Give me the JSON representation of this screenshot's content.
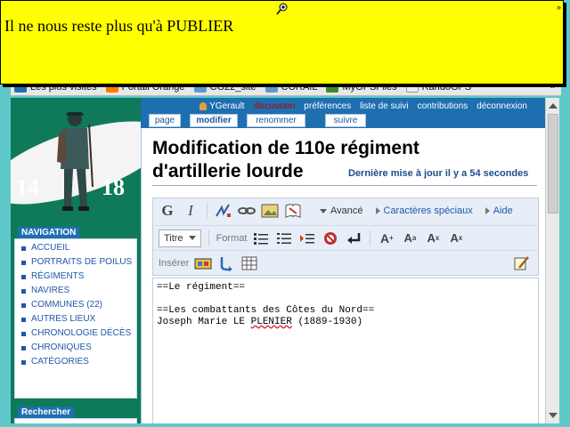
{
  "note": {
    "text": "Il ne nous reste plus qu'à PUBLIER"
  },
  "bookmarks": [
    {
      "label": "Les plus visités",
      "icon": "bookmark-star-icon",
      "color": "#1e6fb0"
    },
    {
      "label": "Portail Orange",
      "icon": "orange-logo-icon",
      "color": "#ff7900"
    },
    {
      "label": "CG22_site",
      "icon": "site-icon",
      "color": "#5a9ad0"
    },
    {
      "label": "CORAIL",
      "icon": "site-icon",
      "color": "#5a9ad0"
    },
    {
      "label": "MyGPSFiles",
      "icon": "gps-icon",
      "color": "#3a8a2a"
    },
    {
      "label": "RandoGPS",
      "icon": "page-icon",
      "color": "#eeeeee"
    }
  ],
  "logo": {
    "left_number": "14",
    "right_number": "18"
  },
  "sidebar": {
    "navigation_heading": "NAVIGATION",
    "nav_items": [
      "ACCUEIL",
      "PORTRAITS DE POILUS",
      "RÉGIMENTS",
      "NAVIRES",
      "COMMUNES (22)",
      "AUTRES LIEUX",
      "CHRONOLOGIE DÉCÈS",
      "CHRONIQUES",
      "CATÉGORIES"
    ],
    "search_heading": "Rechercher"
  },
  "topbar": {
    "user": "YGerault",
    "discussion": "discussion",
    "preferences": "préférences",
    "watchlist": "liste de suivi",
    "contributions": "contributions",
    "logout": "déconnexion"
  },
  "tabs": {
    "page": "page",
    "edit": "modifier",
    "rename": "renommer",
    "watch": "suivre"
  },
  "main": {
    "title": "Modification de 110e régiment d'artillerie lourde",
    "last_modified": "Dernière mise à jour il y a 54 secondes"
  },
  "toolbar": {
    "bold": "G",
    "italic": "I",
    "advanced": "Avancé",
    "special_chars": "Caractères spéciaux",
    "help": "Aide",
    "heading_select": "Titre",
    "format_label": "Format",
    "insert_label": "Insérer"
  },
  "editor": {
    "line1": "==Le régiment==",
    "line2": "",
    "line3": "==Les combattants des Côtes du Nord==",
    "line4_prefix": "Joseph Marie LE ",
    "line4_wavy": "PLENIER",
    "line4_suffix": " (1889-1930)"
  }
}
